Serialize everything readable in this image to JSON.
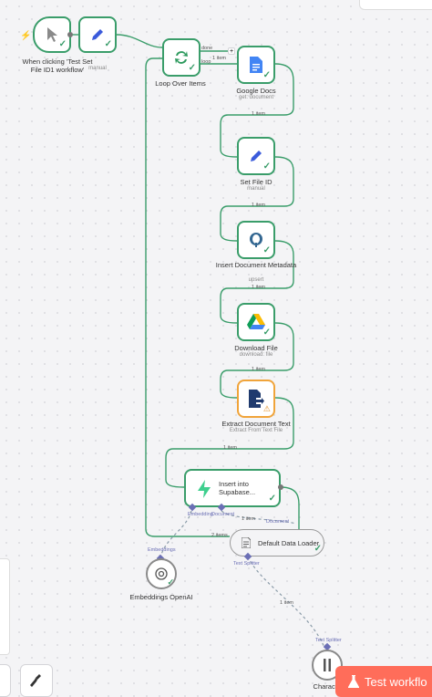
{
  "nodes": {
    "trigger": {
      "label": "When clicking 'Test Set File ID1 workflow'"
    },
    "manual": {
      "subtitle": "manual"
    },
    "loop": {
      "label": "Loop Over Items"
    },
    "google_docs": {
      "label": "Google Docs",
      "subtitle": "get: document"
    },
    "set_file_id": {
      "label": "Set File ID",
      "subtitle": "manual"
    },
    "insert_metadata": {
      "label": "Insert Document Metadata",
      "subtitle": "upsert"
    },
    "download_file": {
      "label": "Download File",
      "subtitle": "download: file"
    },
    "extract_text": {
      "label": "Extract Document Text",
      "subtitle": "Extract From Text File"
    },
    "supabase": {
      "label": "Insert into Supabase..."
    },
    "embeddings": {
      "label": "Embeddings OpenAI"
    },
    "data_loader": {
      "label": "Default Data Loader"
    },
    "char_splitter": {
      "label": "Character"
    }
  },
  "edges": {
    "one_item": "1 item",
    "two_items": "2 items",
    "done": "done",
    "loop": "loop"
  },
  "ports": {
    "embedding": "Embedding",
    "document": "Document",
    "embeddings": "Embeddings",
    "text_splitter": "Text Splitter"
  },
  "toolbar": {
    "test_workflow": "Test workflo"
  },
  "colors": {
    "success": "#3a9d6a",
    "warning": "#f0a43a",
    "accent": "#ff6d5a",
    "ai_port": "#6b6fb5"
  }
}
